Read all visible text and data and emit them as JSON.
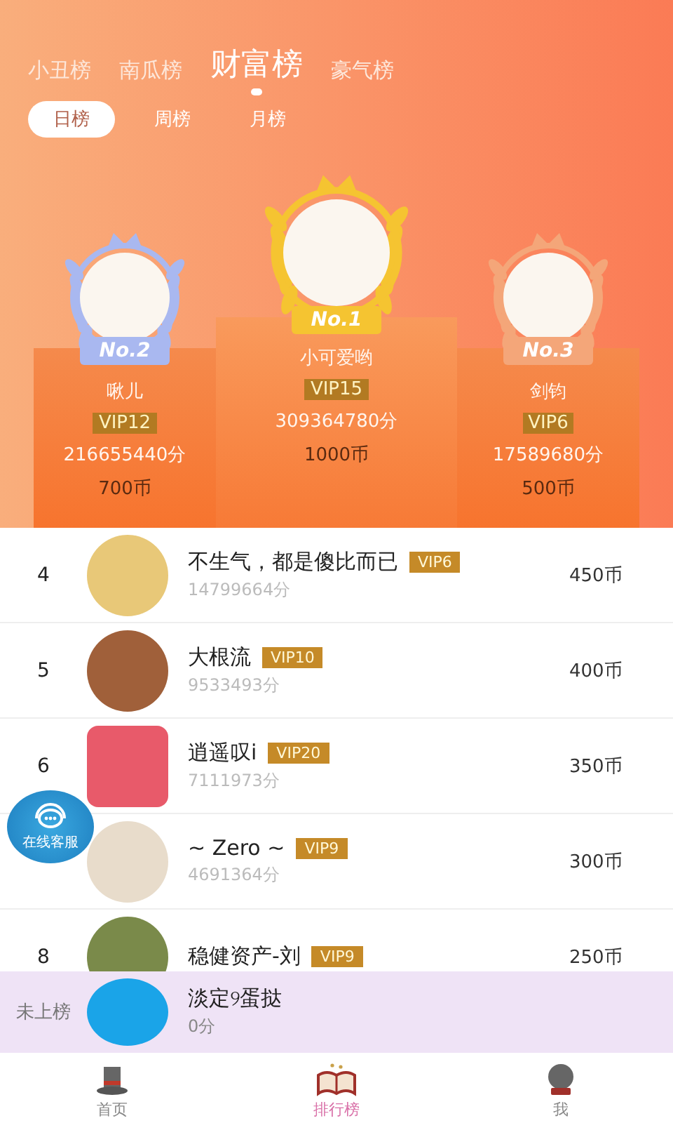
{
  "top_tabs": [
    {
      "label": "小丑榜",
      "selected": false
    },
    {
      "label": "南瓜榜",
      "selected": false
    },
    {
      "label": "财富榜",
      "selected": true
    },
    {
      "label": "豪气榜",
      "selected": false
    }
  ],
  "period_tabs": [
    {
      "label": "日榜",
      "selected": true
    },
    {
      "label": "周榜",
      "selected": false
    },
    {
      "label": "月榜",
      "selected": false
    }
  ],
  "podium": [
    {
      "badge": "No.2",
      "color": "#a9b8f0",
      "name": "啾儿",
      "vip": "VIP12",
      "score": "216655440分",
      "coins": "700币"
    },
    {
      "badge": "No.1",
      "color": "#f5c431",
      "name": "小可爱哟",
      "vip": "VIP15",
      "score": "309364780分",
      "coins": "1000币"
    },
    {
      "badge": "No.3",
      "color": "#f4a679",
      "name": "剑钧",
      "vip": "VIP6",
      "score": "17589680分",
      "coins": "500币"
    }
  ],
  "ranking": [
    {
      "rank": "4",
      "name": "不生气，都是傻比而已",
      "vip": "VIP6",
      "score": "14799664分",
      "coins": "450币"
    },
    {
      "rank": "5",
      "name": "大根流",
      "vip": "VIP10",
      "score": "9533493分",
      "coins": "400币"
    },
    {
      "rank": "6",
      "name": "逍遥叹i",
      "vip": "VIP20",
      "score": "7111973分",
      "coins": "350币"
    },
    {
      "name": "~ Zero ~",
      "vip": "VIP9",
      "score": "4691364分",
      "coins": "300币"
    },
    {
      "rank": "8",
      "name": "稳健资产-刘",
      "vip": "VIP9",
      "coins": "250币"
    }
  ],
  "support_button": {
    "label": "在线客服"
  },
  "my_rank": {
    "rank": "未上榜",
    "name": "淡定୨蛋挞",
    "score": "0分"
  },
  "bottom_nav": [
    {
      "label": "首页",
      "selected": false
    },
    {
      "label": "排行榜",
      "selected": true
    },
    {
      "label": "我",
      "selected": false
    }
  ]
}
